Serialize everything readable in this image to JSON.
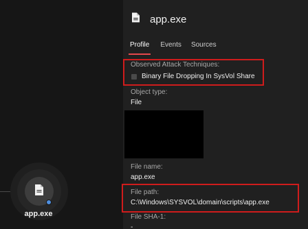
{
  "graph": {
    "node_label": "app.exe",
    "node_icon": "file-icon",
    "status_dot_color": "#4f8fe0"
  },
  "panel": {
    "icon": "file-icon",
    "title": "app.exe",
    "tabs": [
      {
        "label": "Profile",
        "active": true
      },
      {
        "label": "Events",
        "active": false
      },
      {
        "label": "Sources",
        "active": false
      }
    ],
    "observed_label": "Observed Attack Techniques:",
    "techniques": [
      "Binary File Dropping In SysVol Share"
    ],
    "object_type_label": "Object type:",
    "object_type_value": "File",
    "file_name_label": "File name:",
    "file_name_value": "app.exe",
    "file_path_label": "File path:",
    "file_path_value": "C:\\Windows\\SYSVOL\\domain\\scripts\\app.exe",
    "sha1_label": "File SHA-1:",
    "sha1_value": "-"
  },
  "colors": {
    "highlight": "#d01c1c",
    "active_tab": "#e5484d"
  }
}
